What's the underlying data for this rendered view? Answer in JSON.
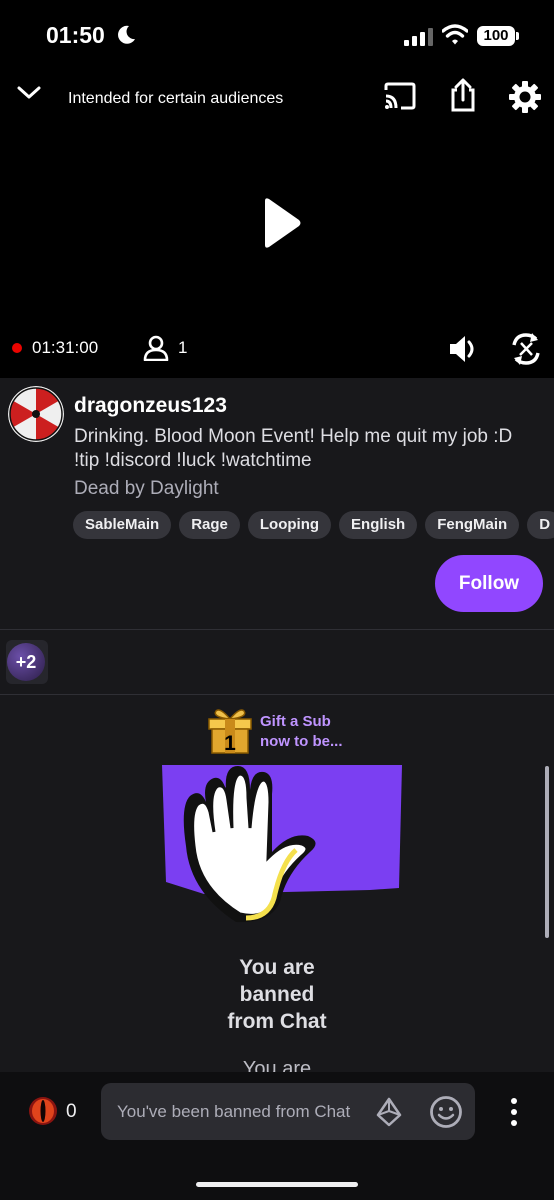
{
  "status_bar": {
    "time": "01:50",
    "battery": "100",
    "icons": [
      "moon-icon",
      "signal-icon",
      "wifi-icon",
      "battery-icon"
    ]
  },
  "player": {
    "audience_label": "Intended for certain audiences",
    "uptime": "01:31:00",
    "viewer_count": "1",
    "icons": [
      "chevron-down-icon",
      "cast-icon",
      "share-icon",
      "settings-icon",
      "play-icon",
      "volume-icon",
      "rotate-icon",
      "viewer-icon",
      "live-dot"
    ]
  },
  "channel": {
    "name": "dragonzeus123",
    "title": "Drinking. Blood Moon Event! Help me quit my job :D !tip !discord !luck !watchtime",
    "category": "Dead by Daylight",
    "tags": [
      "SableMain",
      "Rage",
      "Looping",
      "English",
      "FengMain",
      "D"
    ],
    "follow_label": "Follow"
  },
  "community": {
    "extra_count": "+2"
  },
  "chat": {
    "gift_badge_number": "1",
    "gift_line_1": "Gift a Sub",
    "gift_line_2": "now to be...",
    "banned_lines": [
      "You are",
      "banned",
      "from Chat"
    ],
    "partial_line": "You are"
  },
  "bottom_bar": {
    "points": "0",
    "input_placeholder": "You've been banned from Chat",
    "icons": [
      "channel-points-icon",
      "bits-icon",
      "emote-icon",
      "more-icon"
    ]
  },
  "colors": {
    "accent": "#9147ff",
    "live": "#eb0400",
    "gift_text": "#bf94ff",
    "background": "#18181b",
    "player_background": "#000000"
  }
}
